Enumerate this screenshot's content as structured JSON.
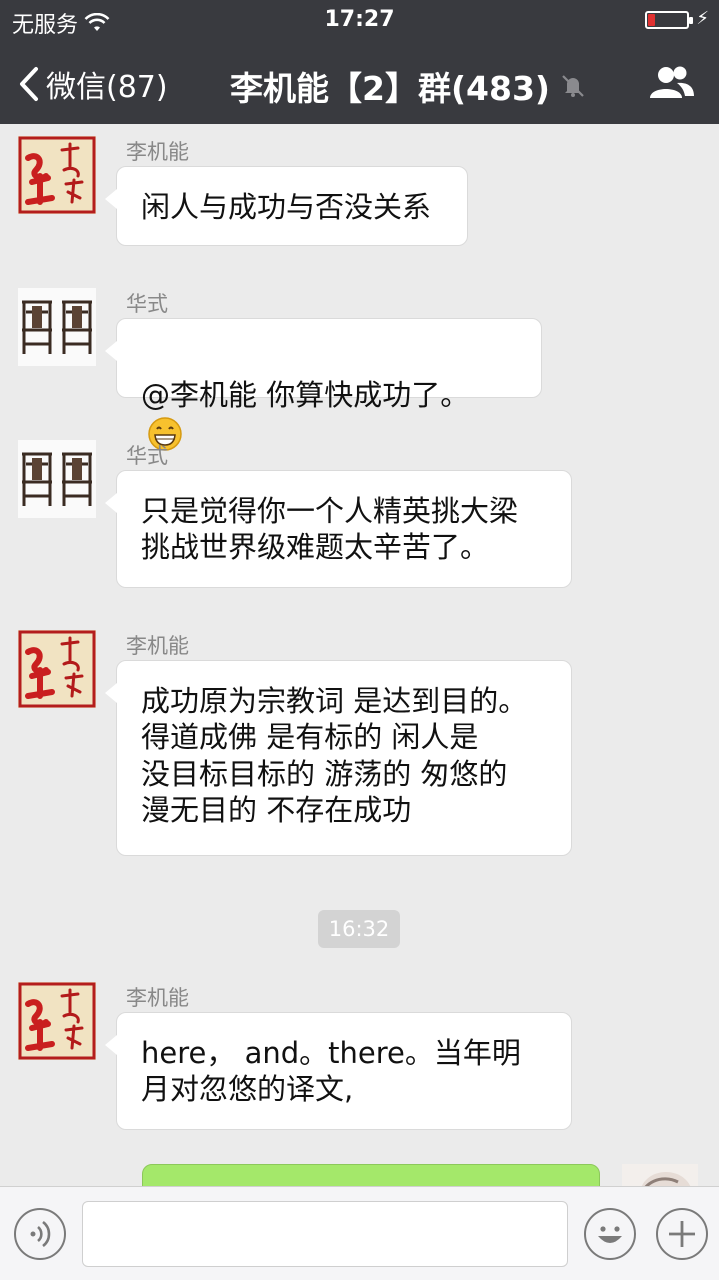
{
  "status_bar": {
    "carrier": "无服务",
    "time": "17:27",
    "battery_level": 0.18,
    "battery_color": "#e03131"
  },
  "nav": {
    "back_label": "微信(87)",
    "title": "李机能【2】群(483)",
    "icons": [
      "chevron-left-icon",
      "mute-bell-icon",
      "group-info-icon"
    ]
  },
  "messages": [
    {
      "sender": "李机能",
      "avatar": "calligraphy-avatar",
      "text": "闲人与成功与否没关系"
    },
    {
      "sender": "华式",
      "avatar": "chairs-avatar",
      "text": "@李机能 你算快成功了。",
      "emoji": "grin-emoji"
    },
    {
      "sender": "华式",
      "avatar": "chairs-avatar",
      "text": "只是觉得你一个人精英挑大梁\n挑战世界级难题太辛苦了。"
    },
    {
      "sender": "李机能",
      "avatar": "calligraphy-avatar",
      "text": "成功原为宗教词 是达到目的。\n得道成佛  是有标的   闲人是\n没目标目标的  游荡的 匆悠的\n 漫无目的  不存在成功"
    },
    {
      "sender": "李机能",
      "avatar": "calligraphy-avatar",
      "text": "here， and。there。当年明\n月对忽悠的译文,"
    }
  ],
  "time_separator": "16:32",
  "input": {
    "value": "",
    "icons": [
      "voice-icon",
      "emoji-icon",
      "plus-icon"
    ]
  },
  "colors": {
    "header_bg": "#393a3f",
    "chat_bg": "#ebebeb",
    "incoming_bubble": "#ffffff",
    "outgoing_bubble": "#a4e86a"
  }
}
